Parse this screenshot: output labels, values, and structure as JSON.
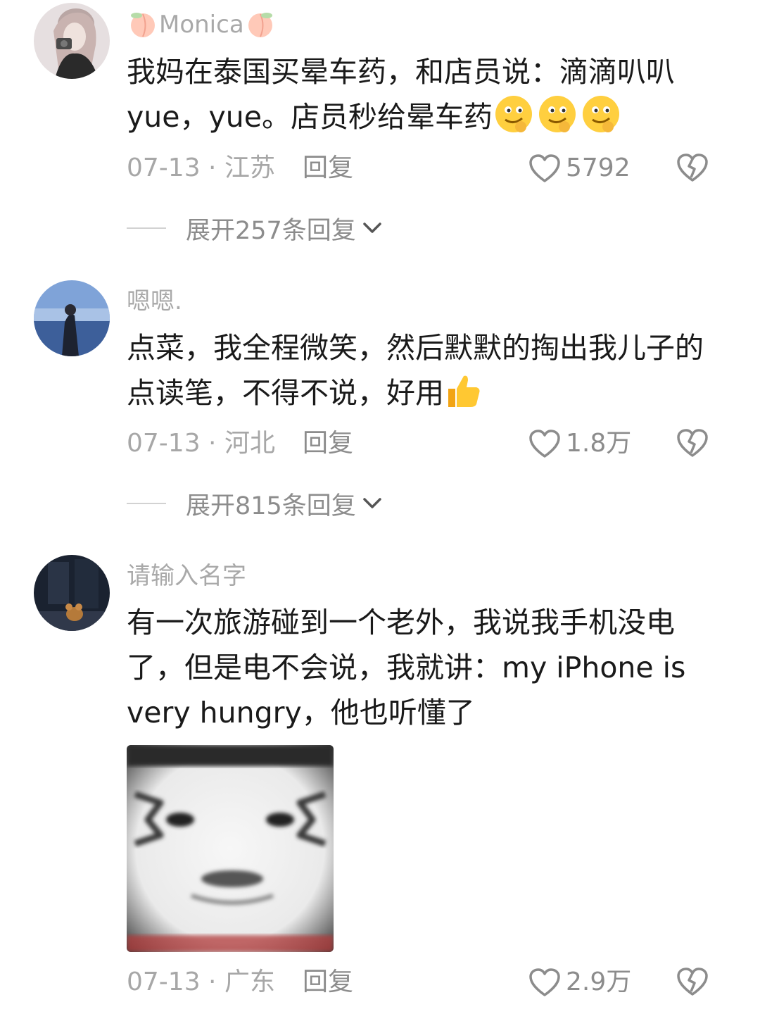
{
  "comments": [
    {
      "username": "Monica",
      "text": "我妈在泰国买晕车药，和店员说：滴滴叭叭yue，yue。店员秒给晕车药",
      "date_location": "07-13 · 江苏",
      "reply_label": "回复",
      "likes": "5792",
      "expand_label": "展开257条回复"
    },
    {
      "username": "嗯嗯.",
      "text": "点菜，我全程微笑，然后默默的掏出我儿子的点读笔，不得不说，好用",
      "date_location": "07-13 · 河北",
      "reply_label": "回复",
      "likes": "1.8万",
      "expand_label": "展开815条回复"
    },
    {
      "username": "请输入名字",
      "text": "有一次旅游碰到一个老外，我说我手机没电了，但是电不会说，我就讲：my iPhone is very hungry，他也听懂了",
      "date_location": "07-13 · 广东",
      "reply_label": "回复",
      "likes": "2.9万"
    }
  ],
  "icons": {
    "like": "heart-outline-icon",
    "dislike": "broken-heart-icon",
    "expand": "chevron-down-icon",
    "emoji_1": "smirk-face-emoji",
    "emoji_2": "thumbs-up-emoji",
    "username_decoration": "peach-emoji"
  },
  "colors": {
    "text_primary": "#1a1a1a",
    "text_secondary": "#a7a7a7",
    "divider": "#d2d2d2"
  }
}
